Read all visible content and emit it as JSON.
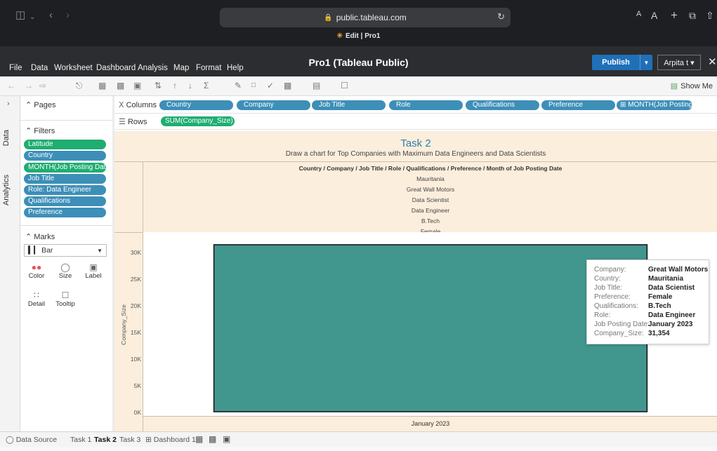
{
  "browser": {
    "url": "public.tableau.com",
    "tab_title": "Edit | Pro1",
    "font_small": "A",
    "font_large": "A"
  },
  "menubar": {
    "items": [
      "File",
      "Data",
      "Worksheet",
      "Dashboard",
      "Analysis",
      "Map",
      "Format",
      "Help"
    ],
    "title": "Pro1 (Tableau Public)",
    "publish_label": "Publish",
    "user_label": "Arpita t ▾"
  },
  "toolbar": {
    "show_me": "Show Me"
  },
  "side_tabs": {
    "data": "Data",
    "analytics": "Analytics"
  },
  "pages": {
    "title": "Pages"
  },
  "filters": {
    "title": "Filters",
    "pills": [
      {
        "label": "Latitude",
        "color": "#1fad72"
      },
      {
        "label": "Country",
        "color": "#3d8fb8"
      },
      {
        "label": "MONTH(Job Posting Date)",
        "color": "#1fad72"
      },
      {
        "label": "Job Title",
        "color": "#3d8fb8"
      },
      {
        "label": "Role: Data Engineer",
        "color": "#3d8fb8"
      },
      {
        "label": "Qualifications",
        "color": "#3d8fb8"
      },
      {
        "label": "Preference",
        "color": "#3d8fb8"
      }
    ]
  },
  "marks": {
    "title": "Marks",
    "type": "Bar",
    "buttons": [
      "Color",
      "Size",
      "Label",
      "Detail",
      "Tooltip"
    ]
  },
  "shelves": {
    "columns_label": "Columns",
    "rows_label": "Rows",
    "columns": [
      "Country",
      "Company",
      "Job Title",
      "Role",
      "Qualifications",
      "Preference",
      "⊞ MONTH(Job Posting..."
    ],
    "rows": [
      "SUM(Company_Size)"
    ]
  },
  "viz": {
    "title": "Task 2",
    "subtitle": "Draw a chart for Top Companies with Maximum Data Engineers and Data Scientists",
    "header_title": "Country / Company / Job Title / Role / Qualifications / Preference / Month of Job Posting Date",
    "header_values": [
      "Mauritania",
      "Great Wall Motors",
      "Data Scientist",
      "Data Engineer",
      "B.Tech",
      "Female"
    ]
  },
  "tooltip": {
    "rows": [
      {
        "k": "Company:",
        "v": "Great Wall Motors"
      },
      {
        "k": "Country:",
        "v": "Mauritania"
      },
      {
        "k": "Job Title:",
        "v": "Data Scientist"
      },
      {
        "k": "Preference:",
        "v": "Female"
      },
      {
        "k": "Qualifications:",
        "v": "B.Tech"
      },
      {
        "k": "Role:",
        "v": "Data Engineer"
      },
      {
        "k": "Job Posting Date:",
        "v": "January 2023"
      },
      {
        "k": "Company_Size:",
        "v": "31,354"
      }
    ]
  },
  "bottom_tabs": {
    "data_source": "Data Source",
    "sheets": [
      "Task 1",
      "Task 2",
      "Task 3",
      "Dashboard 1"
    ],
    "active": "Task 2"
  },
  "chart_data": {
    "type": "bar",
    "categories": [
      "January 2023"
    ],
    "values": [
      31354
    ],
    "xlabel": "",
    "ylabel": "Company_Size",
    "ylim": [
      0,
      32000
    ],
    "yticks": [
      "0K",
      "5K",
      "10K",
      "15K",
      "20K",
      "25K",
      "30K"
    ],
    "bar_color": "#41968d",
    "grid": false
  }
}
